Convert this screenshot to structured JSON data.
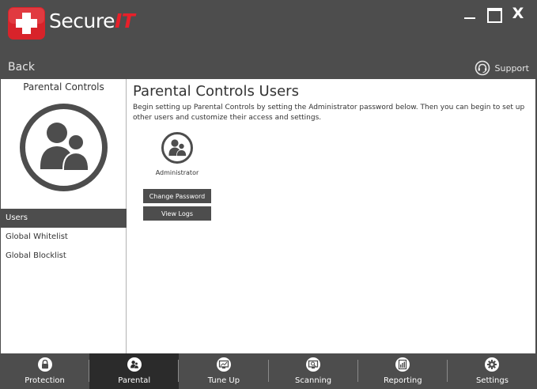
{
  "app": {
    "logo_text_main": "Secure",
    "logo_text_accent": "IT",
    "close_glyph": "X"
  },
  "nav": {
    "back_label": "Back",
    "support_label": "Support"
  },
  "sidebar": {
    "title": "Parental Controls",
    "items": [
      {
        "label": "Users",
        "active": true
      },
      {
        "label": "Global Whitelist",
        "active": false
      },
      {
        "label": "Global Blocklist",
        "active": false
      }
    ]
  },
  "main": {
    "title": "Parental Controls Users",
    "description": "Begin setting up Parental Controls by setting the Administrator password below. Then you can begin to set up other users and customize their access and settings.",
    "user": {
      "name": "Administrator"
    },
    "buttons": {
      "change_password": "Change Password",
      "view_logs": "View Logs"
    }
  },
  "tabs": [
    {
      "label": "Protection",
      "icon": "lock-icon",
      "active": false
    },
    {
      "label": "Parental",
      "icon": "users-icon",
      "active": true
    },
    {
      "label": "Tune Up",
      "icon": "monitor-icon",
      "active": false
    },
    {
      "label": "Scanning",
      "icon": "scan-icon",
      "active": false
    },
    {
      "label": "Reporting",
      "icon": "report-icon",
      "active": false
    },
    {
      "label": "Settings",
      "icon": "gear-icon",
      "active": false
    }
  ],
  "colors": {
    "chrome": "#4d4d4d",
    "active_tab": "#2b2b2b",
    "brand_red": "#e8202a",
    "content_bg": "#ffffff"
  }
}
